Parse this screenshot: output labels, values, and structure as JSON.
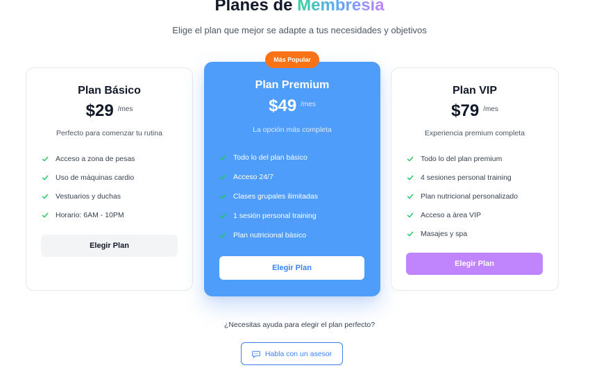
{
  "header": {
    "title_prefix": "Planes de",
    "title_highlight": "Membresía",
    "subtitle": "Elige el plan que mejor se adapte a tus necesidades y objetivos"
  },
  "colors": {
    "accent_blue": "#4f9dfb",
    "check_green": "#22c55e",
    "badge_orange": "#f97316",
    "vip_purple": "#c084fc"
  },
  "plans": [
    {
      "name": "Plan Básico",
      "price": "$29",
      "period": "/mes",
      "description": "Perfecto para comenzar tu rutina",
      "features": [
        "Acceso a zona de pesas",
        "Uso de máquinas cardio",
        "Vestuarios y duchas",
        "Horario: 6AM - 10PM"
      ],
      "button": "Elegir Plan"
    },
    {
      "name": "Plan Premium",
      "badge": "Más Popular",
      "price": "$49",
      "period": "/mes",
      "description": "La opción más completa",
      "features": [
        "Todo lo del plan básico",
        "Acceso 24/7",
        "Clases grupales ilimitadas",
        "1 sesión personal training",
        "Plan nutricional básico"
      ],
      "button": "Elegir Plan"
    },
    {
      "name": "Plan VIP",
      "price": "$79",
      "period": "/mes",
      "description": "Experiencia premium completa",
      "features": [
        "Todo lo del plan premium",
        "4 sesiones personal training",
        "Plan nutricional personalizado",
        "Acceso a área VIP",
        "Masajes y spa"
      ],
      "button": "Elegir Plan"
    }
  ],
  "help": {
    "question": "¿Necesitas ayuda para elegir el plan perfecto?",
    "button": "Habla con un asesor",
    "icon": "chat-icon"
  }
}
